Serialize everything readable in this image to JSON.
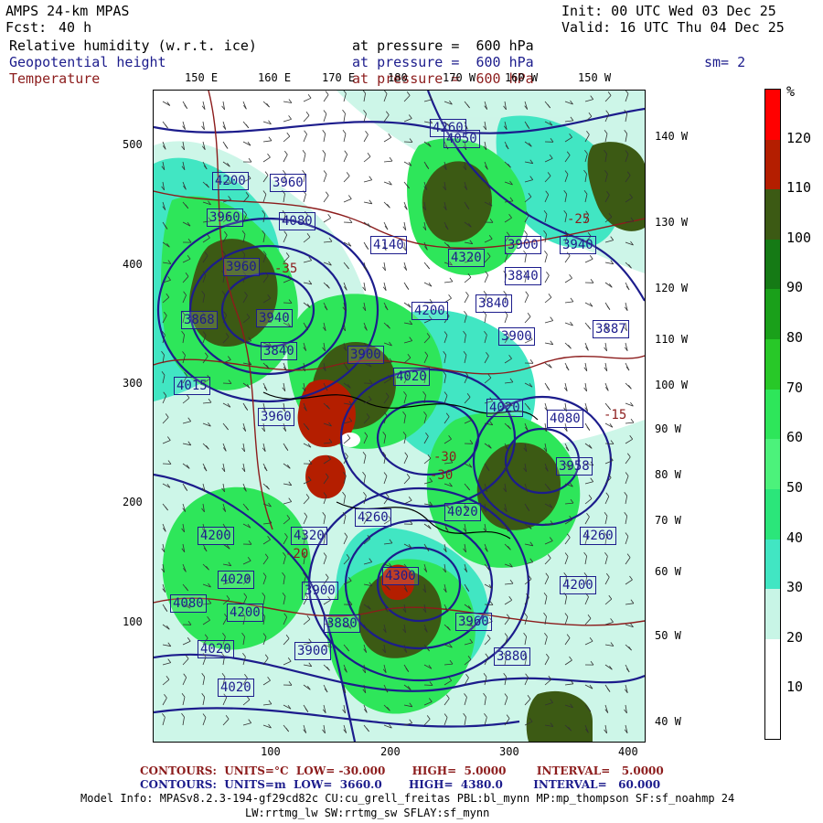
{
  "header": {
    "model": "AMPS 24-km MPAS",
    "init": "Init: 00 UTC Wed 03 Dec 25",
    "fcst_label": "Fcst:",
    "fcst_value": "40 h",
    "valid": "Valid: 16 UTC Thu 04 Dec 25",
    "fields": [
      {
        "name": "Relative humidity (w.r.t. ice)",
        "level": "at pressure =  600 hPa",
        "color": "#000000"
      },
      {
        "name": "Geopotential height",
        "level": "at pressure =  600 hPa",
        "color": "#1c1c8c"
      },
      {
        "name": "Temperature",
        "level": "at pressure =  600 hPa",
        "color": "#8c1c1c"
      }
    ],
    "smoothing": "sm= 2"
  },
  "map": {
    "top_lon_labels": [
      "150 E",
      "160 E",
      "170 E",
      "180",
      "170 W",
      "160 W",
      "150 W"
    ],
    "right_lon_labels": [
      "140 W",
      "130 W",
      "120 W",
      "110 W",
      "100 W",
      "90 W",
      "80 W",
      "70 W",
      "60 W",
      "50 W",
      "40 W"
    ],
    "y_ticks": [
      "500",
      "400",
      "300",
      "200",
      "100"
    ],
    "x_ticks": [
      "100",
      "200",
      "300",
      "400"
    ],
    "height_labels": [
      "4260",
      "4050",
      "4200",
      "3960",
      "3960",
      "4080",
      "4140",
      "4320",
      "3900",
      "3940",
      "3960",
      "3840",
      "3868",
      "3940",
      "3840",
      "3900",
      "4020",
      "4200",
      "3840",
      "3900",
      "3887",
      "4015",
      "3960",
      "4020",
      "4080",
      "3958",
      "4020",
      "4260",
      "4200",
      "4320",
      "4260",
      "4300",
      "3900",
      "4020",
      "4080",
      "4200",
      "3880",
      "3960",
      "4200",
      "4020",
      "3900",
      "3880",
      "4020"
    ],
    "temp_labels": [
      "-30",
      "-30",
      "-20",
      "-25",
      "-15",
      "-35"
    ],
    "rh_colors": {
      "white": "#ffffff",
      "c30": "#c8f5e6",
      "c40": "#41e6c3",
      "c50": "#2be67a",
      "c60": "#4cf27b",
      "c70": "#2ee65a",
      "c80": "#28c828",
      "c90": "#1aa01a",
      "c100": "#157a15",
      "c110": "#3c5a14",
      "c120": "#b41e00",
      "c130": "#ff0000"
    }
  },
  "colorbar": {
    "unit": "%",
    "labels": [
      "120",
      "110",
      "100",
      "90",
      "80",
      "70",
      "60",
      "50",
      "40",
      "30",
      "20",
      "10"
    ],
    "colors": [
      "#ff0000",
      "#b41e00",
      "#3c5a14",
      "#157a15",
      "#1aa01a",
      "#28c828",
      "#2ee65a",
      "#4cf27b",
      "#2be67a",
      "#41e6c3",
      "#c8f5e6",
      "#ffffff",
      "#ffffff"
    ]
  },
  "footer": {
    "contours_temp": "CONTOURS:  UNITS=°C  LOW= -30.000       HIGH=  5.0000        INTERVAL=   5.0000",
    "contours_height": "CONTOURS:  UNITS=m  LOW=  3660.0       HIGH=  4380.0        INTERVAL=   60.000",
    "model_info": "Model Info: MPASv8.2.3-194-gf29cd82c CU:cu_grell_freitas PBL:bl_mynn MP:mp_thompson SF:sf_noahmp 24",
    "model_info2": "LW:rrtmg_lw SW:rrtmg_sw SFLAY:sf_mynn"
  }
}
